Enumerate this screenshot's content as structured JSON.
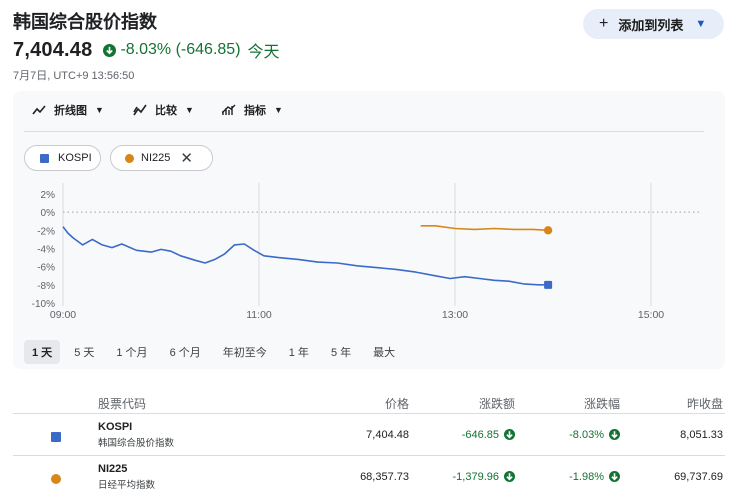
{
  "header": {
    "title": "韩国综合股价指数",
    "add_button_label": "添加到列表"
  },
  "quote": {
    "price": "7,404.48",
    "change": "-8.03% (-646.85)",
    "period": "今天",
    "timestamp": "7月7日, UTC+9 13:56:50"
  },
  "toolbar": {
    "line_chart": "折线图",
    "compare": "比较",
    "indicators": "指标"
  },
  "compare_chips": {
    "kospi": "KOSPI",
    "ni225": "NI225"
  },
  "ranges": [
    "1 天",
    "5 天",
    "1 个月",
    "6 个月",
    "年初至今",
    "1 年",
    "5 年",
    "最大"
  ],
  "colors": {
    "kospi": "#3b6ac9",
    "ni225": "#d98618",
    "negative": "#137333"
  },
  "table": {
    "headers": {
      "symbol": "股票代码",
      "price": "价格",
      "change": "涨跌额",
      "change_pct": "涨跌幅",
      "prev_close": "昨收盘"
    },
    "rows": [
      {
        "symbol": "KOSPI",
        "name": "韩国综合股价指数",
        "price": "7,404.48",
        "change": "-646.85",
        "change_pct": "-8.03%",
        "prev_close": "8,051.33"
      },
      {
        "symbol": "NI225",
        "name": "日经平均指数",
        "price": "68,357.73",
        "change": "-1,379.96",
        "change_pct": "-1.98%",
        "prev_close": "69,737.69"
      }
    ]
  },
  "chart_data": {
    "type": "line",
    "x_ticks": [
      "09:00",
      "11:00",
      "13:00",
      "15:00"
    ],
    "y_ticks": [
      "2%",
      "0%",
      "-2%",
      "-4%",
      "-6%",
      "-8%",
      "-10%"
    ],
    "ylim": [
      -10,
      2
    ],
    "xlim_hours": [
      9,
      15
    ],
    "baseline": 0,
    "series": [
      {
        "name": "KOSPI",
        "color": "#3b6ac9",
        "points": [
          [
            9.0,
            -1.6
          ],
          [
            9.05,
            -2.3
          ],
          [
            9.1,
            -2.8
          ],
          [
            9.2,
            -3.6
          ],
          [
            9.3,
            -3.0
          ],
          [
            9.4,
            -3.6
          ],
          [
            9.5,
            -3.9
          ],
          [
            9.6,
            -3.5
          ],
          [
            9.75,
            -4.2
          ],
          [
            9.9,
            -4.4
          ],
          [
            10.0,
            -4.1
          ],
          [
            10.1,
            -4.3
          ],
          [
            10.2,
            -4.8
          ],
          [
            10.35,
            -5.3
          ],
          [
            10.45,
            -5.6
          ],
          [
            10.55,
            -5.2
          ],
          [
            10.65,
            -4.6
          ],
          [
            10.75,
            -3.6
          ],
          [
            10.85,
            -3.5
          ],
          [
            10.95,
            -4.2
          ],
          [
            11.05,
            -4.8
          ],
          [
            11.2,
            -5.0
          ],
          [
            11.4,
            -5.2
          ],
          [
            11.6,
            -5.5
          ],
          [
            11.8,
            -5.6
          ],
          [
            12.0,
            -5.9
          ],
          [
            12.2,
            -6.1
          ],
          [
            12.4,
            -6.3
          ],
          [
            12.6,
            -6.6
          ],
          [
            12.8,
            -7.0
          ],
          [
            12.95,
            -7.3
          ],
          [
            13.1,
            -7.1
          ],
          [
            13.25,
            -7.3
          ],
          [
            13.4,
            -7.5
          ],
          [
            13.55,
            -7.6
          ],
          [
            13.7,
            -7.9
          ],
          [
            13.85,
            -8.0
          ],
          [
            13.95,
            -8.0
          ]
        ]
      },
      {
        "name": "NI225",
        "color": "#d98618",
        "points": [
          [
            12.65,
            -1.5
          ],
          [
            12.8,
            -1.5
          ],
          [
            13.0,
            -1.8
          ],
          [
            13.2,
            -1.9
          ],
          [
            13.4,
            -1.8
          ],
          [
            13.6,
            -1.9
          ],
          [
            13.8,
            -1.9
          ],
          [
            13.95,
            -2.0
          ]
        ]
      }
    ]
  }
}
